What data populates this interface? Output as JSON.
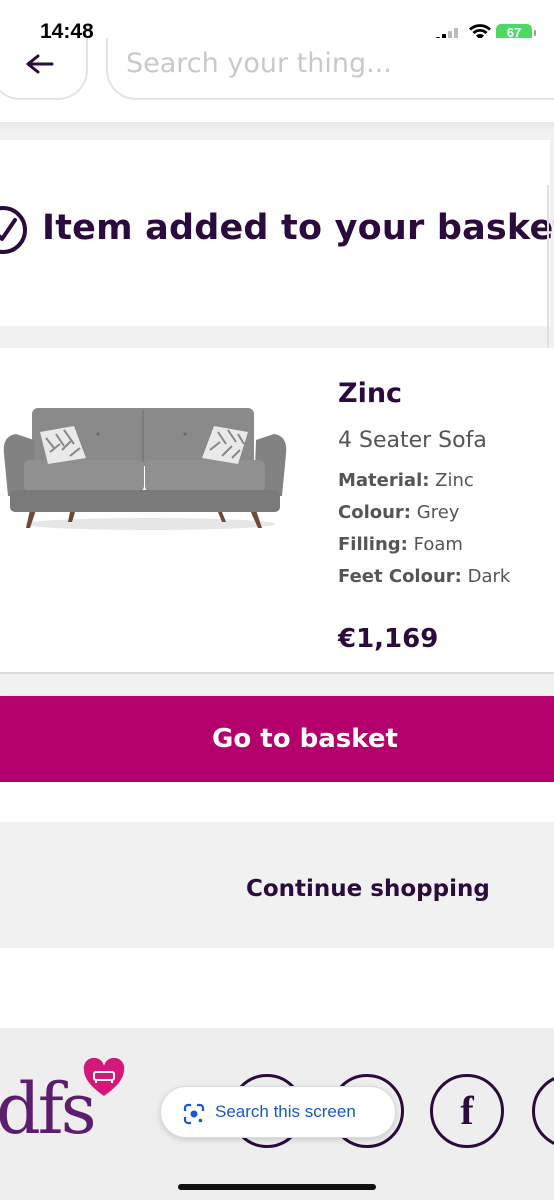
{
  "status_bar": {
    "time": "14:48",
    "battery": "67"
  },
  "header": {
    "search_placeholder": "Search your thing..."
  },
  "confirmation": {
    "title": "Item added to your basket"
  },
  "product": {
    "name": "Zinc",
    "type": "4 Seater Sofa",
    "specs": [
      {
        "label": "Material:",
        "value": "Zinc"
      },
      {
        "label": "Colour:",
        "value": "Grey"
      },
      {
        "label": "Filling:",
        "value": "Foam"
      },
      {
        "label": "Feet Colour:",
        "value": "Dark"
      }
    ],
    "price": "€1,169"
  },
  "actions": {
    "go_to_basket": "Go to basket",
    "continue_shopping": "Continue shopping"
  },
  "footer": {
    "logo": "dfs",
    "facebook_glyph": "f"
  },
  "lens": {
    "label": "Search this screen"
  },
  "colors": {
    "brand_magenta": "#b4006c",
    "brand_purple": "#2b0a3d",
    "logo_purple": "#5b1e6e",
    "heart_pink": "#d6177a"
  },
  "icons": [
    "back-arrow-icon",
    "check-circle-icon",
    "facebook-icon",
    "google-lens-icon",
    "wifi-icon",
    "signal-icon"
  ]
}
